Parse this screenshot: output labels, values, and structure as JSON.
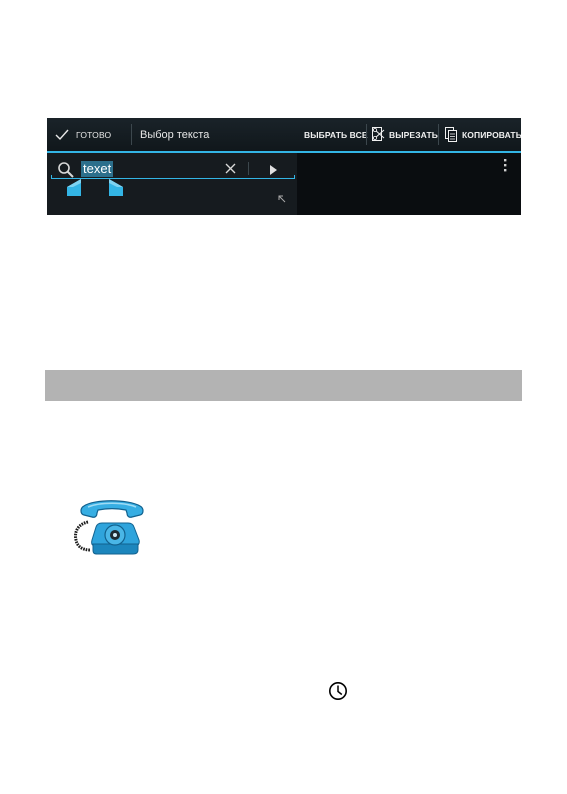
{
  "action_bar": {
    "done_label": "ГОТОВО",
    "title": "Выбор текста",
    "select_all_label": "ВЫБРАТЬ ВСЕ",
    "cut_label": "ВЫРЕЗАТЬ",
    "copy_label": "КОПИРОВАТЬ"
  },
  "search": {
    "query": "texet"
  },
  "colors": {
    "accent": "#33b5e5",
    "selection": "#2c6f8c",
    "band": "#b3b3b3"
  },
  "icons": [
    "check-icon",
    "scissors-icon",
    "copy-icon",
    "search-icon",
    "close-icon",
    "play-arrow-icon",
    "selection-handle-icon",
    "resize-icon",
    "overflow-menu-icon",
    "telephone-icon",
    "clock-icon"
  ]
}
